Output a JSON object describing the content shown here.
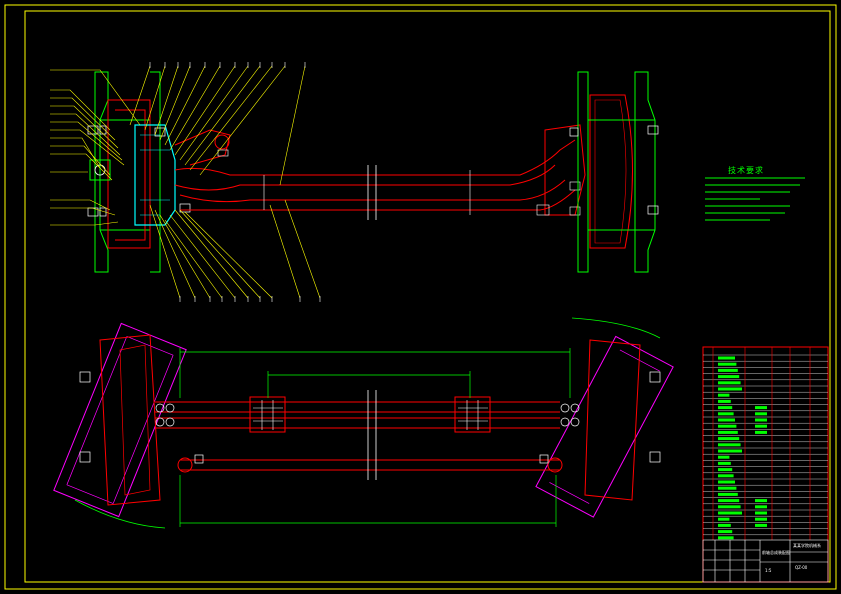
{
  "drawing": {
    "tech_requirements_title": "技术要求",
    "tech_requirement_lines": 6,
    "title_block": {
      "assembly_name": "前轴总成装配图",
      "school": "某某学院机械系",
      "drawing_no": "QZ-00",
      "scale": "1:5"
    }
  },
  "colors": {
    "frame": "#ffff00",
    "outline": "#ff0000",
    "section": "#00ffff",
    "wheel": "#00ff00",
    "brake": "#ff00ff",
    "leader": "#ffff00",
    "text": "#ffffff"
  }
}
